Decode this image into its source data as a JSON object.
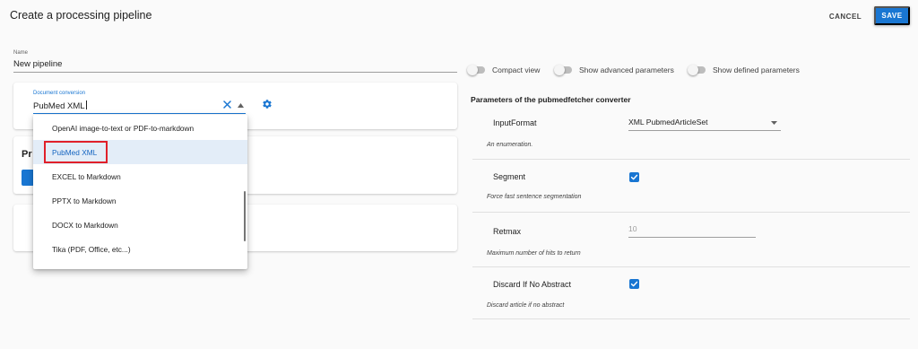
{
  "header": {
    "title": "Create a processing pipeline",
    "cancel_label": "CANCEL",
    "save_label": "SAVE",
    "accent_color": "#1976d2"
  },
  "name_field": {
    "label": "Name",
    "value": "New pipeline"
  },
  "toggles": [
    {
      "label": "Compact view",
      "on": false
    },
    {
      "label": "Show advanced parameters",
      "on": false
    },
    {
      "label": "Show defined parameters",
      "on": false
    }
  ],
  "conversion": {
    "label": "Document conversion",
    "value": "PubMed XML",
    "clear_icon": "close-icon",
    "toggle_icon": "arrow-up-icon",
    "settings_icon": "gear-icon"
  },
  "dropdown": {
    "options": [
      {
        "label": "OpenAI image-to-text or PDF-to-markdown",
        "selected": false
      },
      {
        "label": "PubMed XML",
        "selected": true
      },
      {
        "label": "EXCEL to Markdown",
        "selected": false
      },
      {
        "label": "PPTX to Markdown",
        "selected": false
      },
      {
        "label": "DOCX to Markdown",
        "selected": false
      },
      {
        "label": "Tika (PDF, Office, etc...)",
        "selected": false
      }
    ],
    "highlight_color": "#e0202a"
  },
  "parameters": {
    "title": "Parameters of the pubmedfetcher converter",
    "items": [
      {
        "name": "InputFormat",
        "description": "An enumeration.",
        "type": "select",
        "value": "XML PubmedArticleSet"
      },
      {
        "name": "Segment",
        "description": "Force fast sentence segmentation",
        "type": "checkbox",
        "checked": true
      },
      {
        "name": "Retmax",
        "description": "Maximum number of hits to return",
        "type": "number",
        "value": "10"
      },
      {
        "name": "Discard If No Abstract",
        "description": "Discard article if no abstract",
        "type": "checkbox",
        "checked": true
      }
    ]
  }
}
